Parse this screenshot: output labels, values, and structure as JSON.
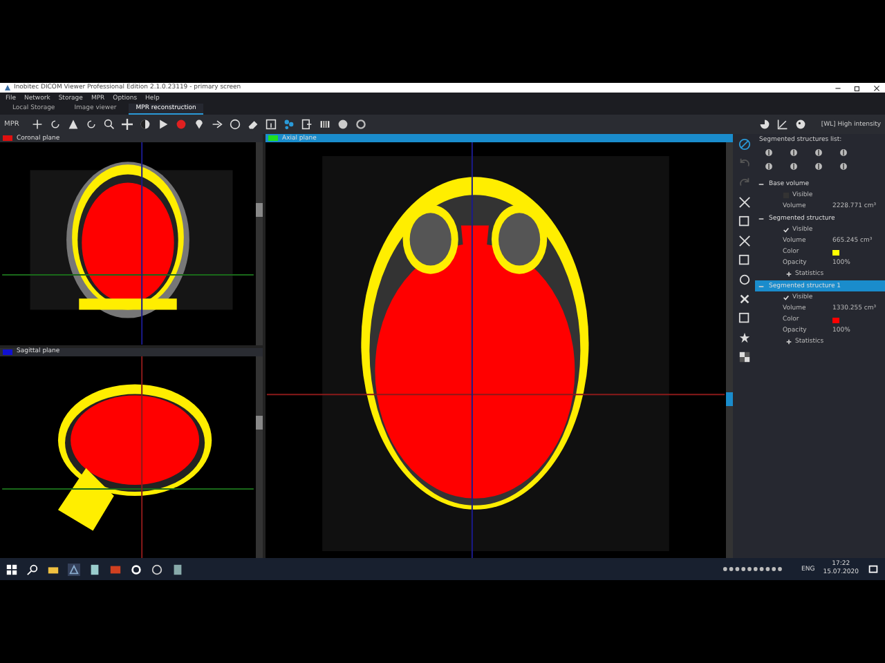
{
  "window": {
    "title": "Inobitec DICOM Viewer Professional Edition 2.1.0.23119 - primary screen"
  },
  "menu": [
    "File",
    "Network",
    "Storage",
    "MPR",
    "Options",
    "Help"
  ],
  "tabs": [
    {
      "label": "Local Storage",
      "selected": false
    },
    {
      "label": "Image viewer",
      "selected": false
    },
    {
      "label": "MPR reconstruction",
      "selected": true
    }
  ],
  "toolbar": {
    "mode": "MPR",
    "preset": "[WL] High intensity"
  },
  "viewports": [
    {
      "label": "Coronal plane",
      "color": "#e01010",
      "selected": false,
      "kind": "coronal"
    },
    {
      "label": "Sagittal plane",
      "color": "#1010d0",
      "selected": false,
      "kind": "sagittal"
    },
    {
      "label": "Axial plane",
      "color": "#20e020",
      "selected": true,
      "kind": "axial"
    }
  ],
  "structures_panel": {
    "title": "Segmented structures list:",
    "items": [
      {
        "name": "Base volume",
        "expanded": true,
        "selected": false,
        "properties": [
          {
            "kind": "check",
            "label": "Visible",
            "checked": false
          },
          {
            "kind": "value",
            "label": "Volume",
            "value": "2228.771 cm³"
          }
        ]
      },
      {
        "name": "Segmented structure",
        "expanded": true,
        "selected": false,
        "properties": [
          {
            "kind": "check",
            "label": "Visible",
            "checked": true
          },
          {
            "kind": "value",
            "label": "Volume",
            "value": "665.245 cm³"
          },
          {
            "kind": "color",
            "label": "Color",
            "color": "#ffff00"
          },
          {
            "kind": "value",
            "label": "Opacity",
            "value": "100%"
          },
          {
            "kind": "group",
            "label": "Statistics",
            "expanded": false
          }
        ]
      },
      {
        "name": "Segmented structure 1",
        "expanded": true,
        "selected": true,
        "properties": [
          {
            "kind": "check",
            "label": "Visible",
            "checked": true
          },
          {
            "kind": "value",
            "label": "Volume",
            "value": "1330.255 cm³"
          },
          {
            "kind": "color",
            "label": "Color",
            "color": "#ff0000"
          },
          {
            "kind": "value",
            "label": "Opacity",
            "value": "100%"
          },
          {
            "kind": "group",
            "label": "Statistics",
            "expanded": false
          }
        ]
      }
    ]
  },
  "taskbar": {
    "language": "ENG",
    "time": "17:22",
    "date": "15.07.2020"
  }
}
